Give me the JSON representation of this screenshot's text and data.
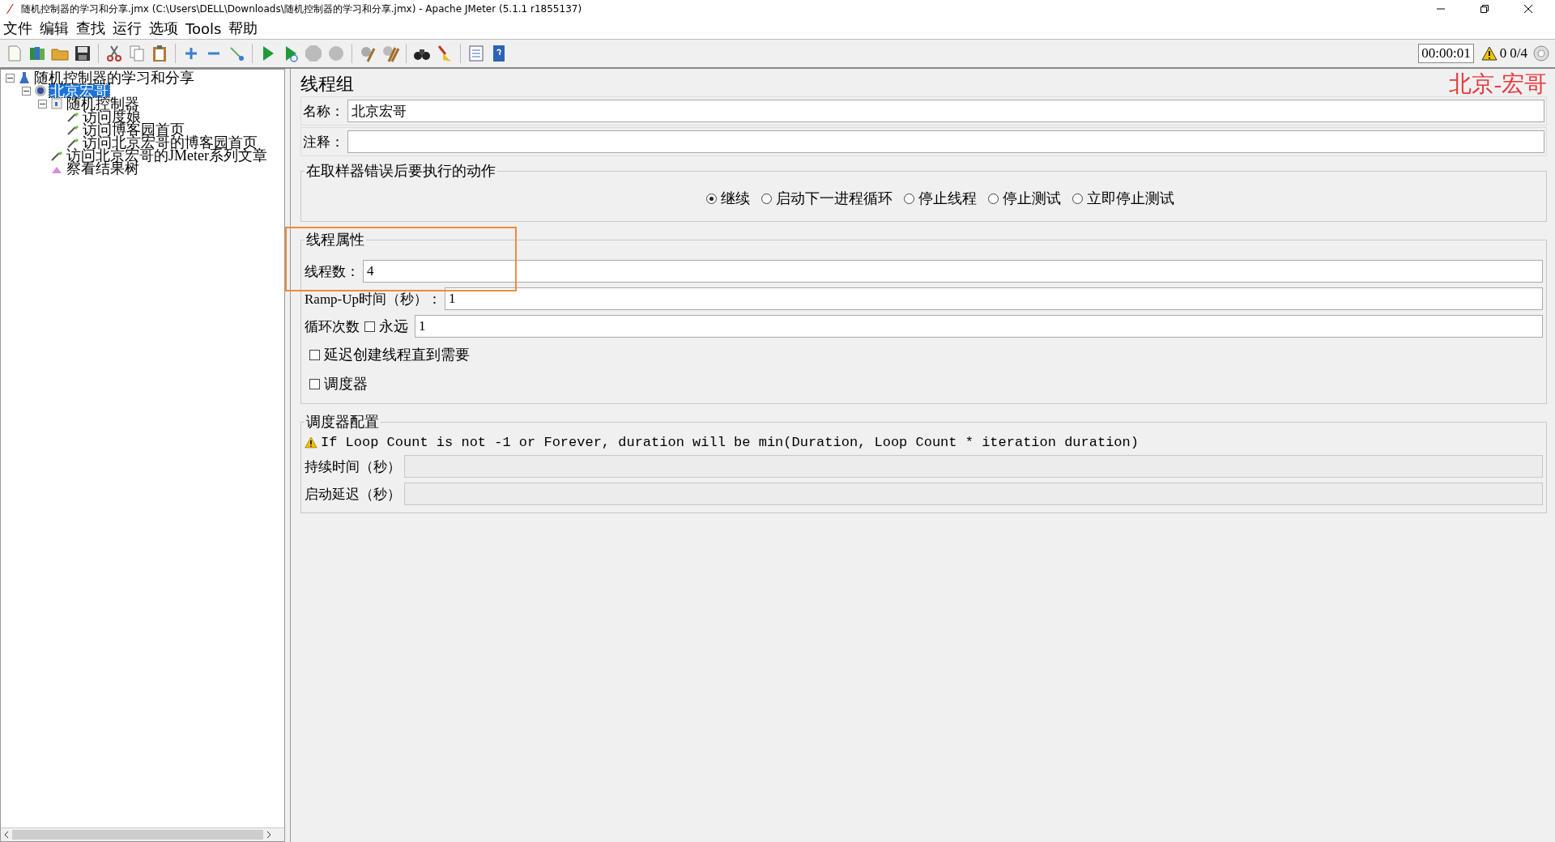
{
  "window": {
    "title": "随机控制器的学习和分享.jmx (C:\\Users\\DELL\\Downloads\\随机控制器的学习和分享.jmx) - Apache JMeter (5.1.1 r1855137)"
  },
  "menu": [
    "文件",
    "编辑",
    "查找",
    "运行",
    "选项",
    "Tools",
    "帮助"
  ],
  "status": {
    "timer": "00:00:01",
    "warnings": "0",
    "threads": "0/4"
  },
  "tree": [
    {
      "label": "随机控制器的学习和分享",
      "kind": "plan",
      "selected": false,
      "expanded": true,
      "children": [
        {
          "label": "北京宏哥",
          "kind": "threadgroup",
          "selected": true,
          "expanded": true,
          "children": [
            {
              "label": "随机控制器",
              "kind": "controller",
              "selected": false,
              "expanded": true,
              "children": [
                {
                  "label": "访问度娘",
                  "kind": "sampler",
                  "selected": false
                },
                {
                  "label": "访问博客园首页",
                  "kind": "sampler",
                  "selected": false
                },
                {
                  "label": "访问北京宏哥的博客园首页",
                  "kind": "sampler",
                  "selected": false
                }
              ]
            },
            {
              "label": "访问北京宏哥的JMeter系列文章",
              "kind": "sampler",
              "selected": false
            },
            {
              "label": "察看结果树",
              "kind": "listener",
              "selected": false
            }
          ]
        }
      ]
    }
  ],
  "panel": {
    "title": "线程组",
    "author_mark": "北京-宏哥",
    "name": {
      "label": "名称：",
      "value": "北京宏哥"
    },
    "comment": {
      "label": "注释："
    },
    "on_error": {
      "title": "在取样器错误后要执行的动作",
      "options": [
        {
          "label": "继续",
          "selected": true
        },
        {
          "label": "启动下一进程循环",
          "selected": false
        },
        {
          "label": "停止线程",
          "selected": false
        },
        {
          "label": "停止测试",
          "selected": false
        },
        {
          "label": "立即停止测试",
          "selected": false
        }
      ]
    },
    "thread_properties": {
      "title": "线程属性",
      "highlighted": true,
      "thread_count": {
        "label": "线程数：",
        "value": "4"
      },
      "ramp_up": {
        "label": "Ramp-Up时间（秒）：",
        "value": "1"
      },
      "loop": {
        "label": "循环次数",
        "forever": {
          "label": "永远",
          "checked": false
        },
        "value": "1"
      },
      "delay_create": {
        "label": "延迟创建线程直到需要",
        "checked": false
      },
      "scheduler": {
        "label": "调度器",
        "checked": false
      }
    },
    "scheduler_config": {
      "title": "调度器配置",
      "warning": "If Loop Count is not -1 or Forever, duration will be min(Duration, Loop Count * iteration duration)",
      "duration": {
        "label": "持续时间（秒）",
        "disabled": true
      },
      "startup_delay": {
        "label": "启动延迟（秒）",
        "disabled": true
      }
    }
  }
}
